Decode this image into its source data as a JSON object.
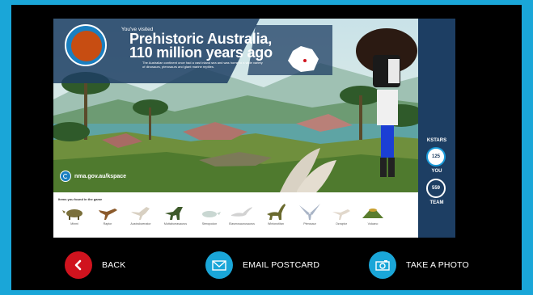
{
  "postcard": {
    "visited_label": "You've visited",
    "title_line1": "Prehistoric Australia,",
    "title_line2": "110 million years ago",
    "description": "The Australian continent once had a vast inland sea and was home to a wide variety of dinosaurs, pterosaurs and giant marine reptiles.",
    "url": "nma.gov.au/kspace",
    "items_title": "Items you found in the game",
    "items": [
      {
        "name": "Minmi"
      },
      {
        "name": "Raptor"
      },
      {
        "name": "Australovenator"
      },
      {
        "name": "Muttaburrasaurus"
      },
      {
        "name": "Steropodon"
      },
      {
        "name": "Elasmosaurusaurus"
      },
      {
        "name": "Wintonotitan"
      },
      {
        "name": "Pterosaur"
      },
      {
        "name": "Ozraptor"
      },
      {
        "name": "Volcano"
      }
    ]
  },
  "kstars": {
    "label": "KSTARS",
    "you_value": "125",
    "you_label": "YOU",
    "team_value": "559",
    "team_label": "TEAM"
  },
  "actions": {
    "back": "BACK",
    "email": "EMAIL POSTCARD",
    "photo": "TAKE A PHOTO"
  },
  "colors": {
    "frame": "#1aa6d8",
    "back_button": "#d0131e",
    "side_panel": "#1d3e63"
  }
}
